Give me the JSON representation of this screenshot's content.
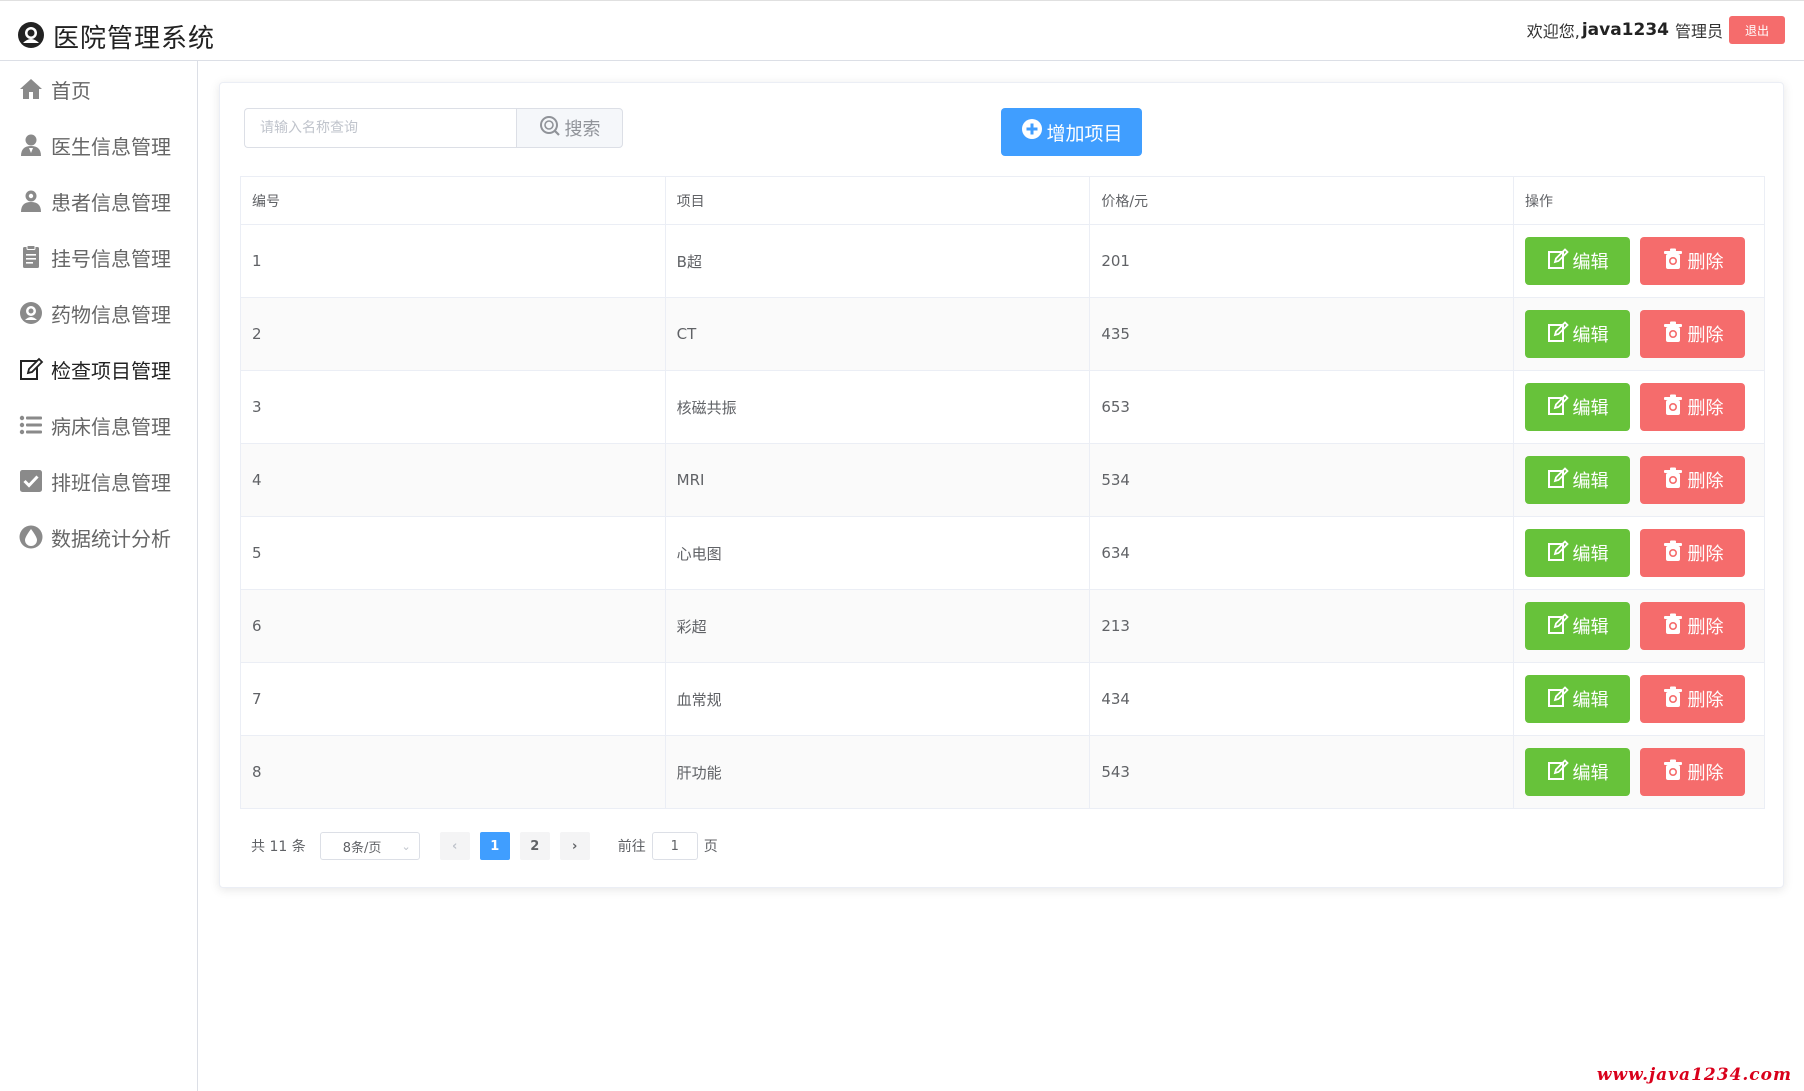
{
  "header": {
    "title": "医院管理系统",
    "welcome": "欢迎您,",
    "username": "java1234",
    "role": "管理员",
    "logout_label": "退出"
  },
  "sidebar": {
    "items": [
      {
        "label": "首页",
        "icon": "home-icon"
      },
      {
        "label": "医生信息管理",
        "icon": "doctor-icon"
      },
      {
        "label": "患者信息管理",
        "icon": "patient-icon"
      },
      {
        "label": "挂号信息管理",
        "icon": "clipboard-icon"
      },
      {
        "label": "药物信息管理",
        "icon": "medicine-icon"
      },
      {
        "label": "检查项目管理",
        "icon": "edit-icon",
        "active": true
      },
      {
        "label": "病床信息管理",
        "icon": "list-icon"
      },
      {
        "label": "排班信息管理",
        "icon": "checkbox-icon"
      },
      {
        "label": "数据统计分析",
        "icon": "drop-icon"
      }
    ]
  },
  "toolbar": {
    "search_placeholder": "请输入名称查询",
    "search_label": "搜索",
    "add_label": "增加项目"
  },
  "table": {
    "columns": [
      "编号",
      "项目",
      "价格/元",
      "操作"
    ],
    "rows": [
      {
        "id": "1",
        "name": "B超",
        "price": "201"
      },
      {
        "id": "2",
        "name": "CT",
        "price": "435"
      },
      {
        "id": "3",
        "name": "核磁共振",
        "price": "653"
      },
      {
        "id": "4",
        "name": "MRI",
        "price": "534"
      },
      {
        "id": "5",
        "name": "心电图",
        "price": "634"
      },
      {
        "id": "6",
        "name": "彩超",
        "price": "213"
      },
      {
        "id": "7",
        "name": "血常规",
        "price": "434"
      },
      {
        "id": "8",
        "name": "肝功能",
        "price": "543"
      }
    ],
    "edit_label": "编辑",
    "delete_label": "删除"
  },
  "pagination": {
    "total_text": "共 11 条",
    "page_size": "8条/页",
    "prev_symbol": "‹",
    "next_symbol": "›",
    "pages": [
      "1",
      "2"
    ],
    "current_page": "1",
    "goto_label": "前往",
    "goto_value": "1",
    "goto_suffix": "页"
  },
  "watermark": "www.java1234.com",
  "colors": {
    "primary": "#409eff",
    "success": "#67c23a",
    "danger": "#f56c6c"
  }
}
